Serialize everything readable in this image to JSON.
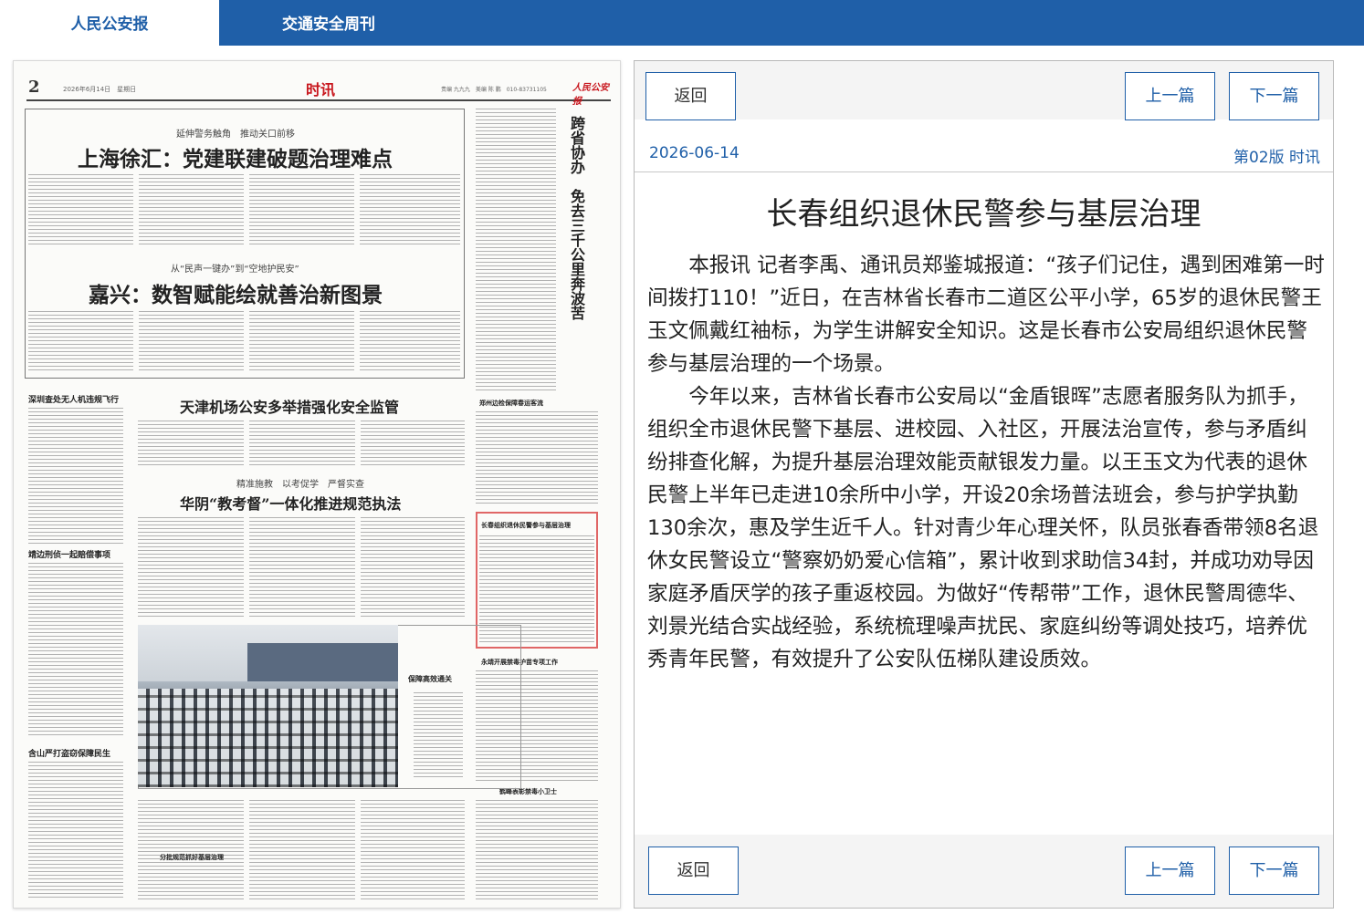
{
  "tabs": [
    {
      "label": "人民公安报",
      "active": true
    },
    {
      "label": "交通安全周刊",
      "active": false
    }
  ],
  "paper": {
    "page_number": "2",
    "date_line": "2026年6月14日　星期日",
    "section": "时讯",
    "editor_line": "责编 九九九　美编 陈 鹏　010-83731105",
    "logo": "人民公安报",
    "headlines": [
      {
        "kicker": "延伸警务触角　推动关口前移",
        "title": "上海徐汇：党建联建破题治理难点"
      },
      {
        "kicker": "从“民声一键办”到“空地护民安”",
        "title": "嘉兴：数智赋能绘就善治新图景"
      },
      {
        "kicker": "",
        "title": "天津机场公安多举措强化安全监管"
      },
      {
        "kicker": "精准施教　以考促学　严督实查",
        "title": "华阴“教考督”一体化推进规范执法"
      }
    ],
    "vertical_title": "跨省协办　免去三千公里奔波苦",
    "side_titles": [
      "深圳查处无人机违规飞行",
      "靖边刑侦一起赔偿事项",
      "含山严打盗窃保障民生",
      "郑州边检保障春运客流",
      "长春组织退休民警参与基层治理",
      "永靖开展禁毒护苗专项工作",
      "鹤峰表彰禁毒小卫士",
      "保障高效通关",
      "分批规范抓好基层治理"
    ]
  },
  "article": {
    "back_label": "返回",
    "prev_label": "上一篇",
    "next_label": "下一篇",
    "date": "2026-06-14",
    "section_label": "第02版 时讯",
    "title": "长春组织退休民警参与基层治理",
    "paragraphs": [
      "本报讯 记者李禹、通讯员郑鉴城报道：“孩子们记住，遇到困难第一时间拨打110！”近日，在吉林省长春市二道区公平小学，65岁的退休民警王玉文佩戴红袖标，为学生讲解安全知识。这是长春市公安局组织退休民警参与基层治理的一个场景。",
      "今年以来，吉林省长春市公安局以“金盾银晖”志愿者服务队为抓手，组织全市退休民警下基层、进校园、入社区，开展法治宣传，参与矛盾纠纷排查化解，为提升基层治理效能贡献银发力量。以王玉文为代表的退休民警上半年已走进10余所中小学，开设20余场普法班会，参与护学执勤130余次，惠及学生近千人。针对青少年心理关怀，队员张春香带领8名退休女民警设立“警察奶奶爱心信箱”，累计收到求助信34封，并成功劝导因家庭矛盾厌学的孩子重返校园。为做好“传帮带”工作，退休民警周德华、刘景光结合实战经验，系统梳理噪声扰民、家庭纠纷等调处技巧，培养优秀青年民警，有效提升了公安队伍梯队建设质效。"
    ]
  },
  "colors": {
    "brand_blue": "#1f5fa8",
    "paper_red": "#c8161d",
    "selection_red": "#e06666"
  }
}
